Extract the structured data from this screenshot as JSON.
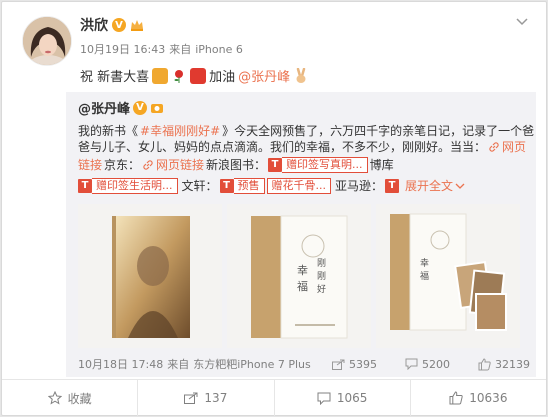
{
  "post": {
    "author": "洪欣",
    "time": "10月19日 16:43",
    "via_prefix": "来自",
    "source": "iPhone 6",
    "text_prefix": "祝 新書大喜",
    "text_mid": "加油",
    "mention": "@张丹峰"
  },
  "repost": {
    "author": "@张丹峰",
    "line1_pre": "我的新书《",
    "hashtag": "#幸福刚刚好#",
    "line1_post": "》今天全网预售了，六万四千字的亲笔日记，记录了一个爸",
    "line2": "爸与儿子、女儿、妈妈的点点滴滴。我们的幸福，不多不少，刚刚好。当当：",
    "link_label": "网页",
    "line3_a": "链接",
    "line3_b": "京东：",
    "link2": "网页链接",
    "line3_c": "新浪图书：",
    "tag1": "赠印签写真明...",
    "line3_d": "博库",
    "tag2": "赠印签生活明...",
    "line4_a": "文轩：",
    "tag3": "预售",
    "tag4": "赠花千骨...",
    "line4_b": "亚马逊：",
    "expand": "展开全文",
    "time": "10月18日 17:48",
    "via_prefix": "来自",
    "source": "东方粑粑iPhone 7 Plus",
    "shares": "5395",
    "comments": "5200",
    "likes": "32139"
  },
  "actions": {
    "favorite": "收藏",
    "repost": "137",
    "comment": "1065",
    "like": "10636"
  },
  "book": {
    "title_chars": [
      "幸",
      "福",
      "刚",
      "刚",
      "好"
    ]
  },
  "colors": {
    "accent": "#eb7350",
    "tag_red": "#e24e3a",
    "vbadge": "#f5a623"
  }
}
